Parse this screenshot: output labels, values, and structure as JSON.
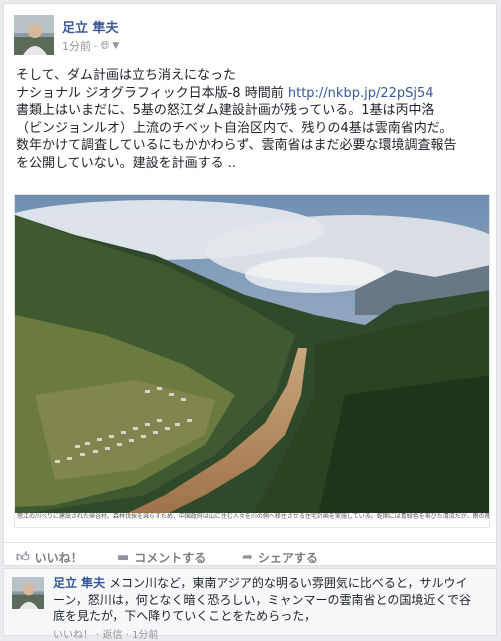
{
  "post": {
    "author": "足立 隼夫",
    "timestamp": "1分前",
    "privacy_icon": "globe-icon",
    "body_lines": [
      "そして、ダム計画は立ち消えになった",
      "ナショナル ジオグラフィック日本版-8 時間前",
      "書類上はいまだに、5基の怒江ダム建設計画が残っている。1基は丙中洛",
      "（ビンジョンルオ）上流のチベット自治区内で、残りの4基は雲南省内だ。",
      "数年かけて調査しているにもかかわらず、雲南省はまだ必要な環境調査報告",
      "を公開していない。建設を計画する .."
    ],
    "link": "http://nkbp.jp/22pSj54",
    "photo_caption": "怒江の川べりに建設された帰谷村。森林伐採を減らすため、中国政府は山に住む人々を川の側へ移住させる住宅計画を実施している。乾期には青緑色を帯びた清流だが、雨の降る夏は流域にある農業が流れ込んで茶色く濁る。（PHOTOGRAPH BY ADAM DEAN, NATIONAL GEOGRAPHIC）"
  },
  "actions": {
    "like": "いいね！",
    "comment": "コメントする",
    "share": "シェアする"
  },
  "comment": {
    "author": "足立 隼夫",
    "lines": [
      " メコン川など，東南アジア的な明るい雰囲気に比べると，サルウイ",
      "ーン，怒川は，何となく暗く恐ろしい，ミャンマーの雲南省との国境近くで谷",
      "底を見たが，下へ降りていくことをためらった，"
    ],
    "footer": "いいね！ · 返信 · 1分前"
  },
  "colors": {
    "link": "#365899",
    "author": "#3b5998",
    "meta": "#90949c"
  }
}
